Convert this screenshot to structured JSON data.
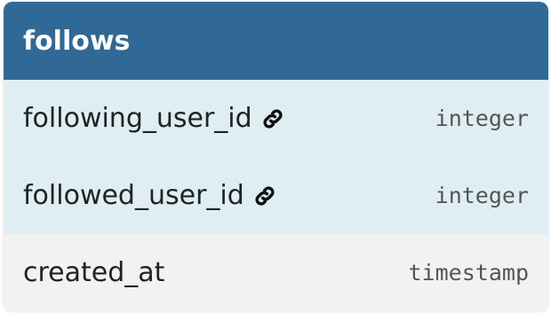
{
  "table": {
    "title": "follows",
    "header_color": "#306896",
    "fields": [
      {
        "name": "following_user_id",
        "type": "integer",
        "foreign_key": true,
        "icon": "link-icon"
      },
      {
        "name": "followed_user_id",
        "type": "integer",
        "foreign_key": true,
        "icon": "link-icon"
      },
      {
        "name": "created_at",
        "type": "timestamp",
        "foreign_key": false
      }
    ]
  }
}
